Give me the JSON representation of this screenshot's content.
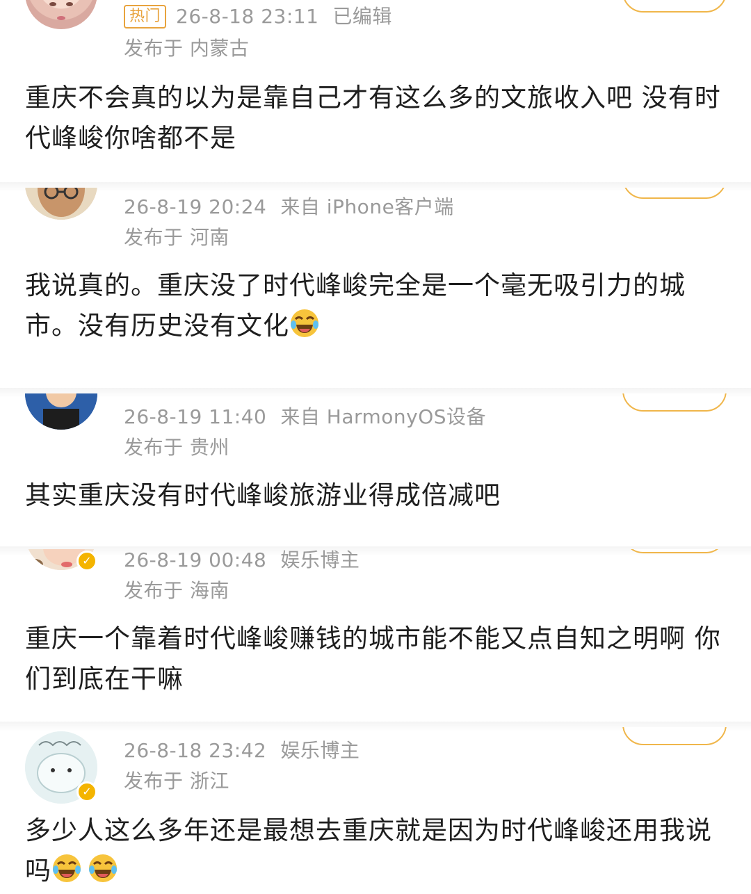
{
  "comments": [
    {
      "hot_tag": "热门",
      "time": "26-8-18 23:11",
      "edited": "已编辑",
      "source": "",
      "location": "发布于 内蒙古",
      "text": "重庆不会真的以为是靠自己才有这么多的文旅收入吧 没有时代峰峻你啥都不是"
    },
    {
      "time": "26-8-19 20:24",
      "source": "来自 iPhone客户端",
      "location": "发布于 河南",
      "text": "我说真的。重庆没了时代峰峻完全是一个毫无吸引力的城市。没有历史没有文化"
    },
    {
      "time": "26-8-19 11:40",
      "source": "来自 HarmonyOS设备",
      "location": "发布于 贵州",
      "text": "其实重庆没有时代峰峻旅游业得成倍减吧"
    },
    {
      "time": "26-8-19 00:48",
      "source": "娱乐博主",
      "location": "发布于 海南",
      "text": "重庆一个靠着时代峰峻赚钱的城市能不能又点自知之明啊 你们到底在干嘛"
    },
    {
      "time": "26-8-18 23:42",
      "source": "娱乐博主",
      "location": "发布于 浙江",
      "text": "多少人这么多年还是最想去重庆就是因为时代峰峻还用我说吗"
    }
  ],
  "icons": {
    "emoji": "laughing-crying-face-icon",
    "verified": "verified-badge-icon"
  },
  "colors": {
    "meta": "#9a9a9a",
    "follow_border": "#f0b64a",
    "verified": "#f4b400"
  }
}
